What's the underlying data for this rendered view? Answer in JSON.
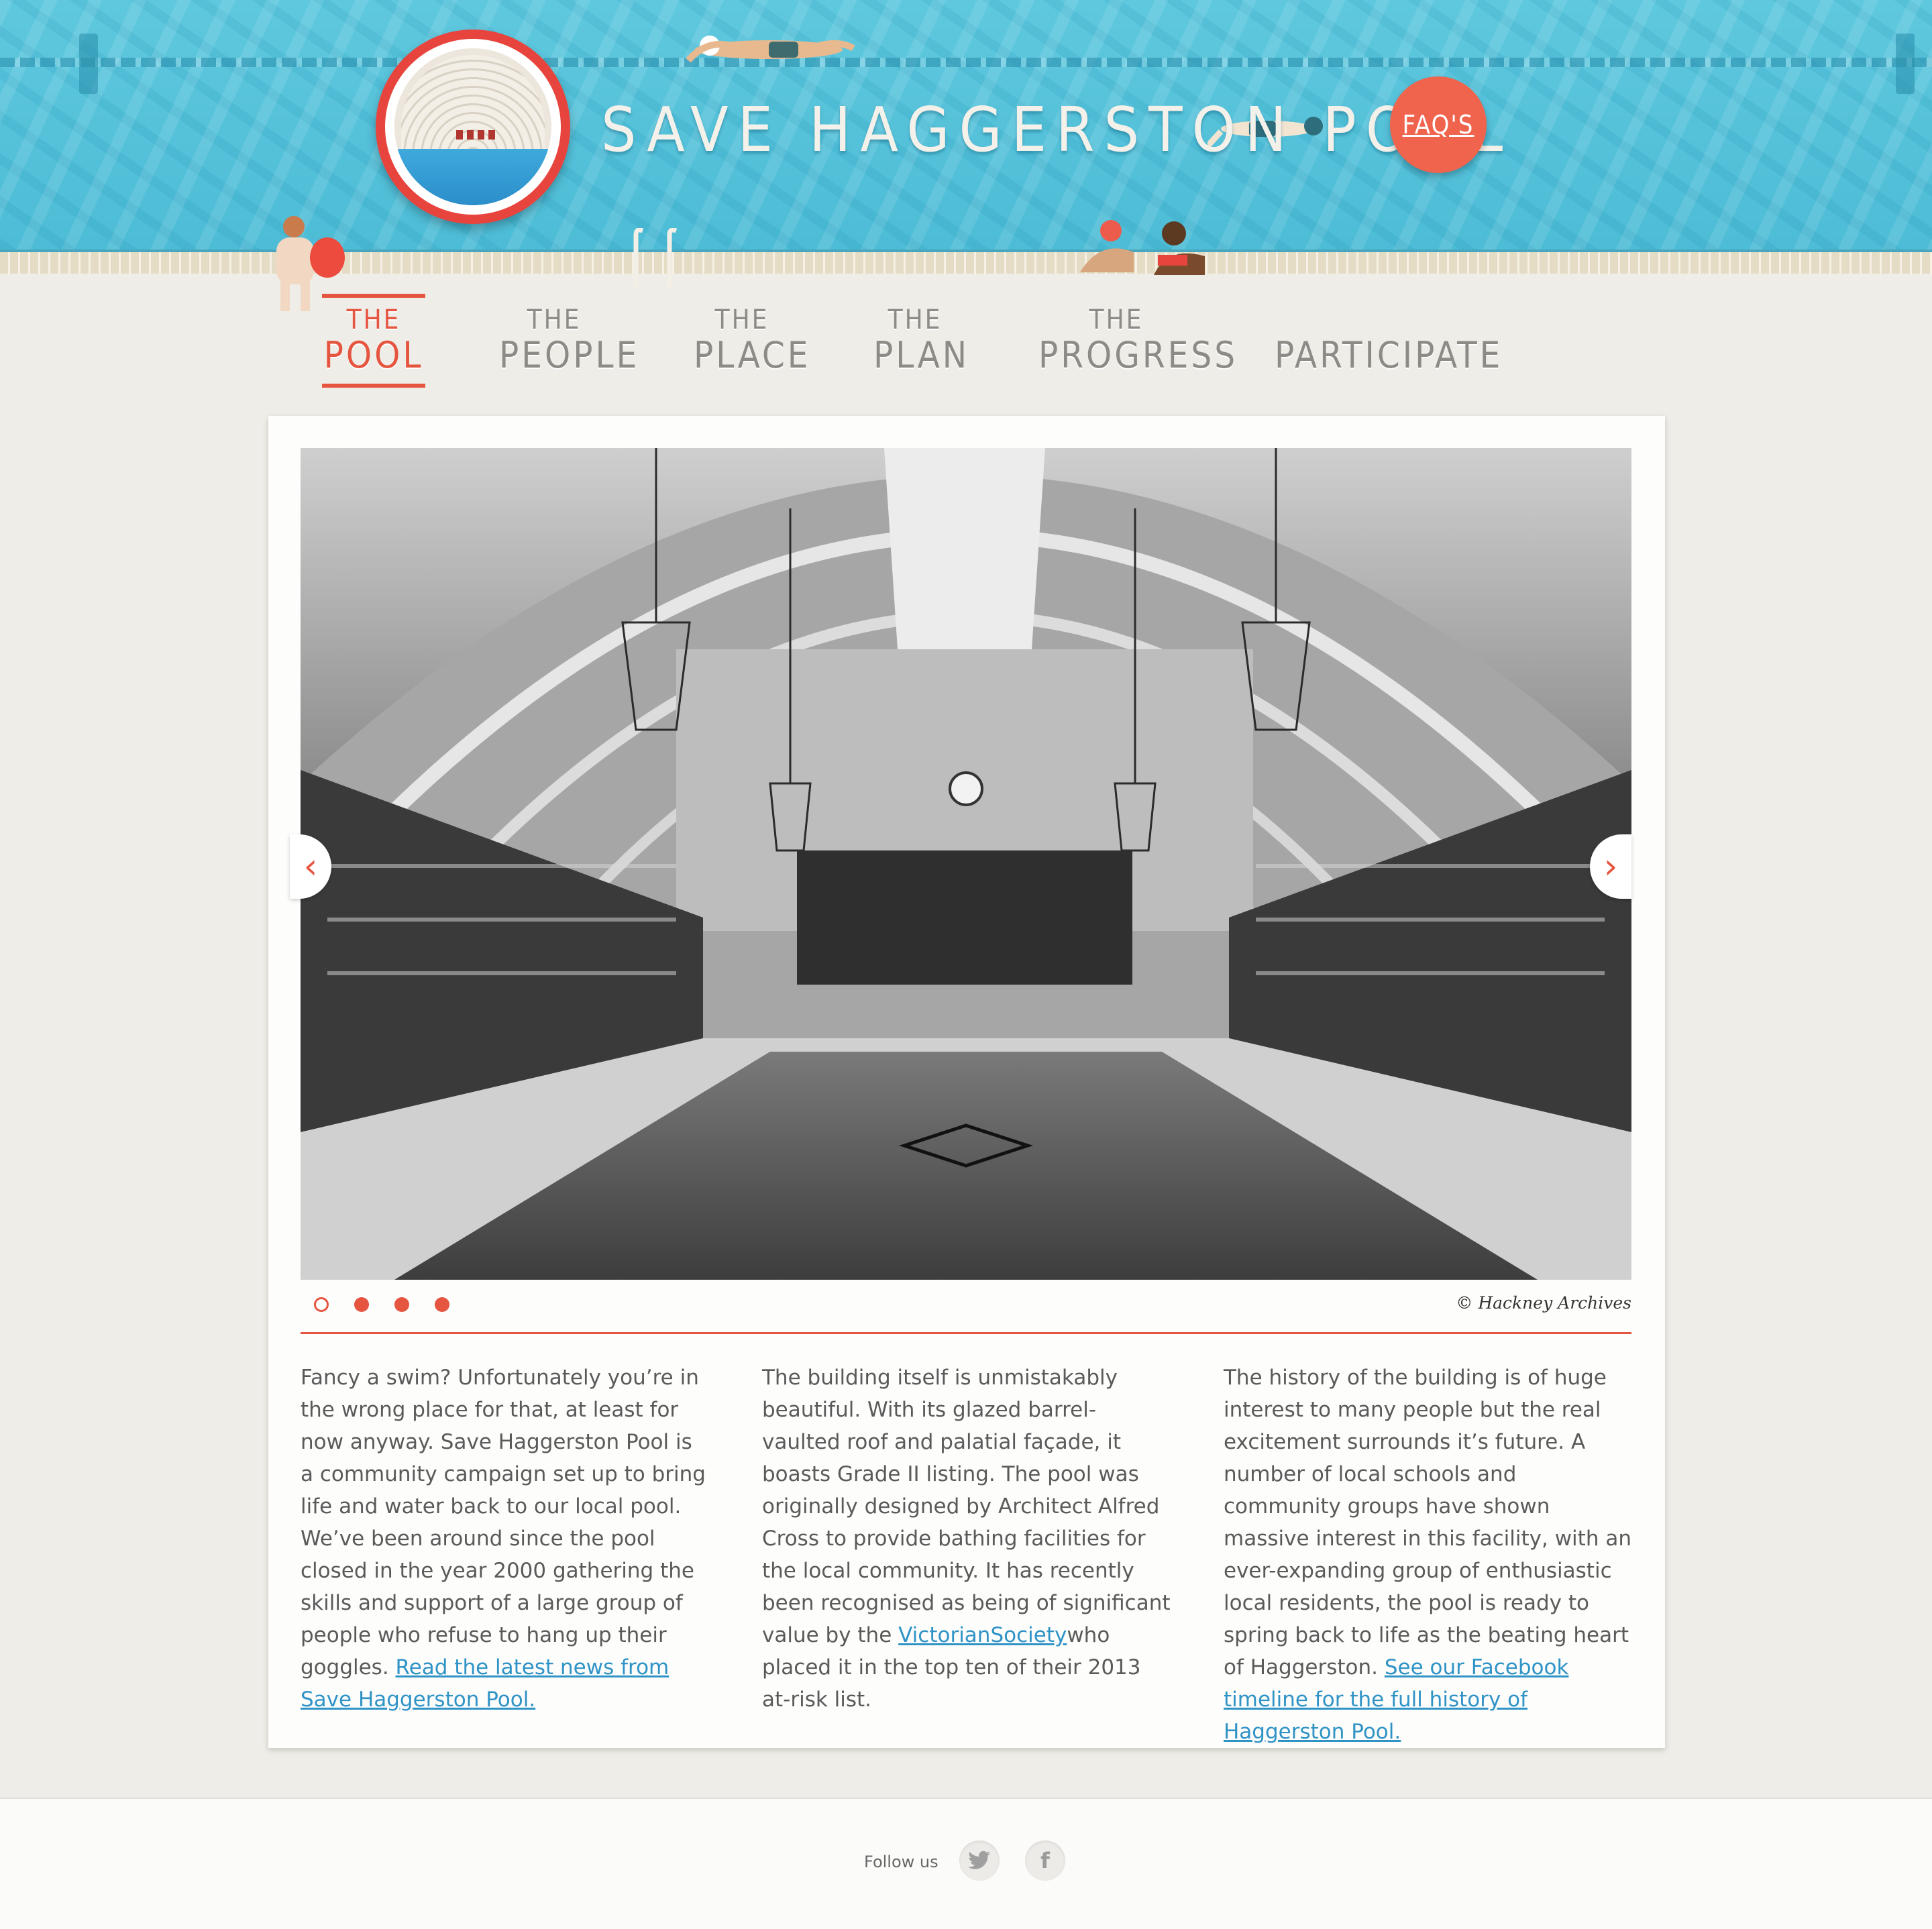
{
  "header": {
    "title": "SAVE HAGGERSTON POOL",
    "faq_label": "FAQ'S"
  },
  "nav": {
    "items": [
      {
        "small": "THE",
        "big": "POOL",
        "active": true
      },
      {
        "small": "THE",
        "big": "PEOPLE",
        "active": false
      },
      {
        "small": "THE",
        "big": "PLACE",
        "active": false
      },
      {
        "small": "THE",
        "big": "PLAN",
        "active": false
      },
      {
        "small": "THE",
        "big": "PROGRESS",
        "active": false
      },
      {
        "small": "",
        "big": "PARTICIPATE",
        "active": false
      }
    ]
  },
  "slider": {
    "prev_icon": "chevron-left-icon",
    "next_icon": "chevron-right-icon",
    "prev_glyph": "‹",
    "next_glyph": "›",
    "slide_count": 4,
    "current_slide": 1,
    "credit": "© Hackney Archives"
  },
  "columns": [
    {
      "text": "Fancy a swim? Unfortunately you’re in the wrong place for that, at least for now anyway. Save Haggerston Pool is a community campaign set up to bring life and water back to our local pool. We’ve been around since the pool closed in the year 2000 gathering the skills and support of a large group of people who refuse to hang up their goggles. ",
      "link": "Read the latest news from Save Haggerston Pool.",
      "after": ""
    },
    {
      "text": "The building itself is unmistakably beautiful. With its glazed barrel-vaulted roof and palatial façade, it boasts Grade II listing. The pool was originally designed by Architect Alfred Cross to provide bathing facilities for the local community. It has recently been recognised as being of significant value by the ",
      "link": "VictorianSociety",
      "after": "who placed it in the top ten of their 2013 at-risk list."
    },
    {
      "text": "The history of the building is of huge interest to many people but the real excitement surrounds it’s future. A number of local schools and community groups have shown massive interest in this facility, with an ever-expanding group of enthusiastic local residents, the pool is ready to spring back to life as the beating heart of Haggerston. ",
      "link": "See our Facebook timeline for the full history of Haggerston Pool.",
      "after": ""
    }
  ],
  "footer": {
    "follow_label": "Follow us",
    "twitter_icon": "twitter-icon",
    "facebook_icon": "facebook-icon",
    "facebook_glyph": "f"
  },
  "colors": {
    "accent": "#e5553f",
    "water": "#4dbcd6",
    "link": "#2f93c6"
  }
}
